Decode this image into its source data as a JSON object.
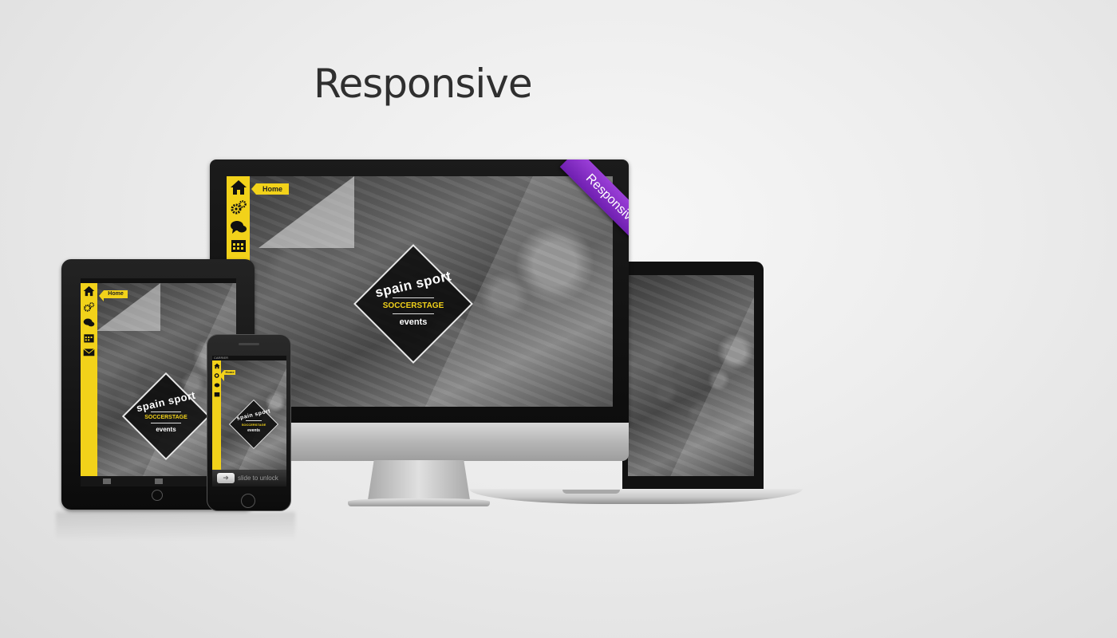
{
  "heading": "Responsive",
  "ribbon": "Responsive",
  "brand": {
    "line1": "spain sport",
    "line2": "SOCCERSTAGE",
    "line3": "events"
  },
  "nav": {
    "home_label": "Home",
    "icons": [
      "home-icon",
      "gears-icon",
      "chat-icon",
      "calendar-icon",
      "mail-icon"
    ]
  },
  "iphone": {
    "carrier": "CARRIER",
    "slide_text": "slide to unlock"
  },
  "colors": {
    "accent": "#f2d21a",
    "ribbon": "#8a32cc",
    "heading": "#2f2f2f"
  }
}
